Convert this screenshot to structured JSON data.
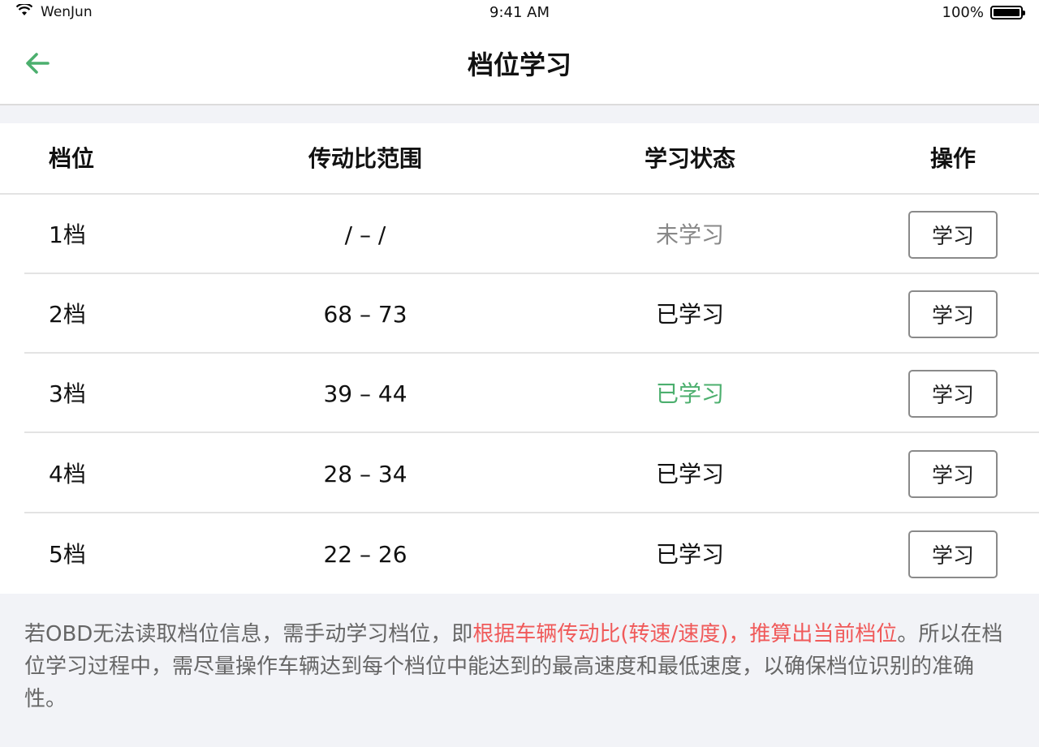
{
  "status_bar": {
    "carrier": "WenJun",
    "time": "9:41 AM",
    "battery": "100%",
    "wifi_icon": "wifi-icon",
    "battery_level": 1.0
  },
  "nav": {
    "title": "档位学习",
    "back_icon": "arrow-left-icon",
    "accent_color": "#4caf6e"
  },
  "table": {
    "headers": {
      "gear": "档位",
      "ratio": "传动比范围",
      "status": "学习状态",
      "action": "操作"
    },
    "rows": [
      {
        "gear": "1档",
        "ratio": "/  –  /",
        "status": "未学习",
        "status_color": "#888888",
        "button": "学习"
      },
      {
        "gear": "2档",
        "ratio": "68 – 73",
        "status": "已学习",
        "status_color": "#111111",
        "button": "学习"
      },
      {
        "gear": "3档",
        "ratio": "39 – 44",
        "status": "已学习",
        "status_color": "#4caf6e",
        "button": "学习"
      },
      {
        "gear": "4档",
        "ratio": "28 – 34",
        "status": "已学习",
        "status_color": "#111111",
        "button": "学习"
      },
      {
        "gear": "5档",
        "ratio": "22 – 26",
        "status": "已学习",
        "status_color": "#111111",
        "button": "学习"
      }
    ]
  },
  "note": {
    "part1": "若OBD无法读取档位信息，需手动学习档位，即",
    "highlight": "根据车辆传动比(转速/速度)，推算出当前档位",
    "part2": "。所以在档位学习过程中，需尽量操作车辆达到每个档位中能达到的最高速度和最低速度，以确保档位识别的准确性。",
    "highlight_color": "#f05a5a"
  }
}
